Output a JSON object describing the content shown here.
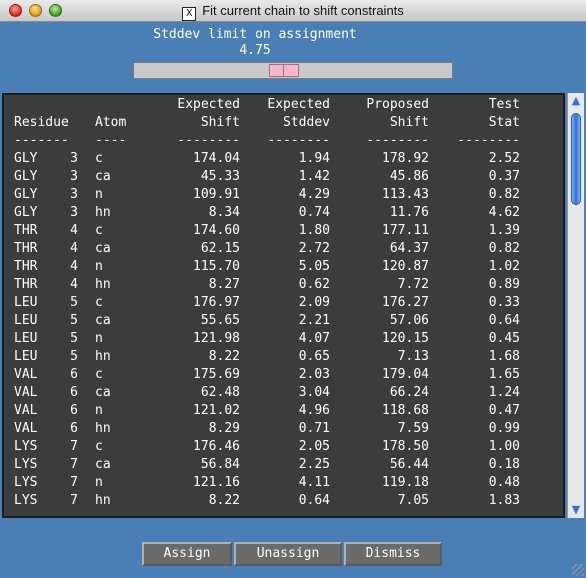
{
  "window": {
    "title": "Fit current chain to shift constraints",
    "title_icon": "X"
  },
  "slider": {
    "label": "Stddev limit on assignment",
    "value": "4.75",
    "fraction": 0.47
  },
  "table": {
    "headers_line1": [
      "",
      "",
      "Expected",
      "Expected",
      "Proposed",
      "Test"
    ],
    "headers_line2": [
      "Residue",
      "Atom",
      "Shift",
      "Stddev",
      "Shift",
      "Stat"
    ],
    "separators": [
      "-------",
      "----",
      "--------",
      "--------",
      "--------",
      "--------"
    ],
    "rows": [
      [
        "GLY",
        "3",
        "c",
        "174.04",
        "1.94",
        "178.92",
        "2.52"
      ],
      [
        "GLY",
        "3",
        "ca",
        "45.33",
        "1.42",
        "45.86",
        "0.37"
      ],
      [
        "GLY",
        "3",
        "n",
        "109.91",
        "4.29",
        "113.43",
        "0.82"
      ],
      [
        "GLY",
        "3",
        "hn",
        "8.34",
        "0.74",
        "11.76",
        "4.62"
      ],
      [
        "THR",
        "4",
        "c",
        "174.60",
        "1.80",
        "177.11",
        "1.39"
      ],
      [
        "THR",
        "4",
        "ca",
        "62.15",
        "2.72",
        "64.37",
        "0.82"
      ],
      [
        "THR",
        "4",
        "n",
        "115.70",
        "5.05",
        "120.87",
        "1.02"
      ],
      [
        "THR",
        "4",
        "hn",
        "8.27",
        "0.62",
        "7.72",
        "0.89"
      ],
      [
        "LEU",
        "5",
        "c",
        "176.97",
        "2.09",
        "176.27",
        "0.33"
      ],
      [
        "LEU",
        "5",
        "ca",
        "55.65",
        "2.21",
        "57.06",
        "0.64"
      ],
      [
        "LEU",
        "5",
        "n",
        "121.98",
        "4.07",
        "120.15",
        "0.45"
      ],
      [
        "LEU",
        "5",
        "hn",
        "8.22",
        "0.65",
        "7.13",
        "1.68"
      ],
      [
        "VAL",
        "6",
        "c",
        "175.69",
        "2.03",
        "179.04",
        "1.65"
      ],
      [
        "VAL",
        "6",
        "ca",
        "62.48",
        "3.04",
        "66.24",
        "1.24"
      ],
      [
        "VAL",
        "6",
        "n",
        "121.02",
        "4.96",
        "118.68",
        "0.47"
      ],
      [
        "VAL",
        "6",
        "hn",
        "8.29",
        "0.71",
        "7.59",
        "0.99"
      ],
      [
        "LYS",
        "7",
        "c",
        "176.46",
        "2.05",
        "178.50",
        "1.00"
      ],
      [
        "LYS",
        "7",
        "ca",
        "56.84",
        "2.25",
        "56.44",
        "0.18"
      ],
      [
        "LYS",
        "7",
        "n",
        "121.16",
        "4.11",
        "119.18",
        "0.48"
      ],
      [
        "LYS",
        "7",
        "hn",
        "8.22",
        "0.64",
        "7.05",
        "1.83"
      ]
    ]
  },
  "buttons": {
    "assign": "Assign",
    "unassign": "Unassign",
    "dismiss": "Dismiss"
  },
  "icons": {
    "scroll_up": "up-arrow-icon",
    "scroll_down": "down-arrow-icon"
  }
}
